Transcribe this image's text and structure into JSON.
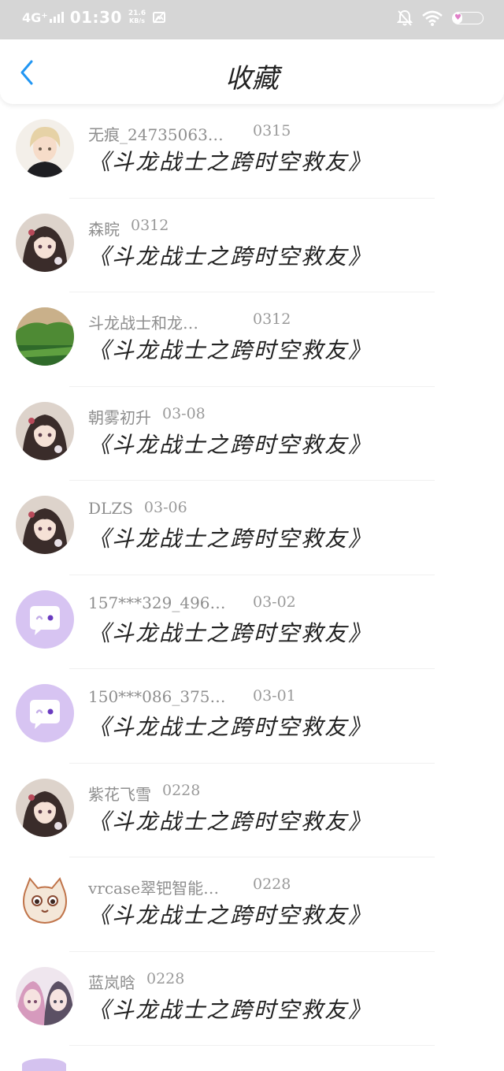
{
  "status_bar": {
    "signal": "4G⁺",
    "time": "01:30",
    "speed_value": "21.6",
    "speed_unit": "KB/s",
    "battery": "32",
    "battery_level": 0.32,
    "icons": [
      "signal-icon",
      "screenshot-icon",
      "bell-off-icon",
      "wifi-icon",
      "battery-icon"
    ]
  },
  "header": {
    "title": "收藏",
    "back_icon": "chevron-left-icon",
    "accent_color": "#2196f3"
  },
  "items": [
    {
      "username": "无痕_24735063…",
      "date": "0315",
      "message": "《斗龙战士之跨时空救友》",
      "avatar": "anime-boy-avatar"
    },
    {
      "username": "森睆",
      "date": "0312",
      "message": "《斗龙战士之跨时空救友》",
      "avatar": "anime-girl-avatar"
    },
    {
      "username": "斗龙战士和龙…",
      "date": "0312",
      "message": "《斗龙战士之跨时空救友》",
      "avatar": "landscape-avatar"
    },
    {
      "username": "朝雾初升",
      "date": "03-08",
      "message": "《斗龙战士之跨时空救友》",
      "avatar": "anime-girl-avatar"
    },
    {
      "username": "DLZS",
      "date": "03-06",
      "message": "《斗龙战士之跨时空救友》",
      "avatar": "anime-girl-avatar"
    },
    {
      "username": "157***329_496…",
      "date": "03-02",
      "message": "《斗龙战士之跨时空救友》",
      "avatar": "default-chat-avatar"
    },
    {
      "username": "150***086_375…",
      "date": "03-01",
      "message": "《斗龙战士之跨时空救友》",
      "avatar": "default-chat-avatar"
    },
    {
      "username": "紫花飞雪",
      "date": "0228",
      "message": "《斗龙战士之跨时空救友》",
      "avatar": "anime-girl-avatar"
    },
    {
      "username": "vrcase翠钯智能…",
      "date": "0228",
      "message": "《斗龙战士之跨时空救友》",
      "avatar": "cat-avatar"
    },
    {
      "username": "蓝岚晗",
      "date": "0228",
      "message": "《斗龙战士之跨时空救友》",
      "avatar": "anime-girls-avatar"
    }
  ]
}
